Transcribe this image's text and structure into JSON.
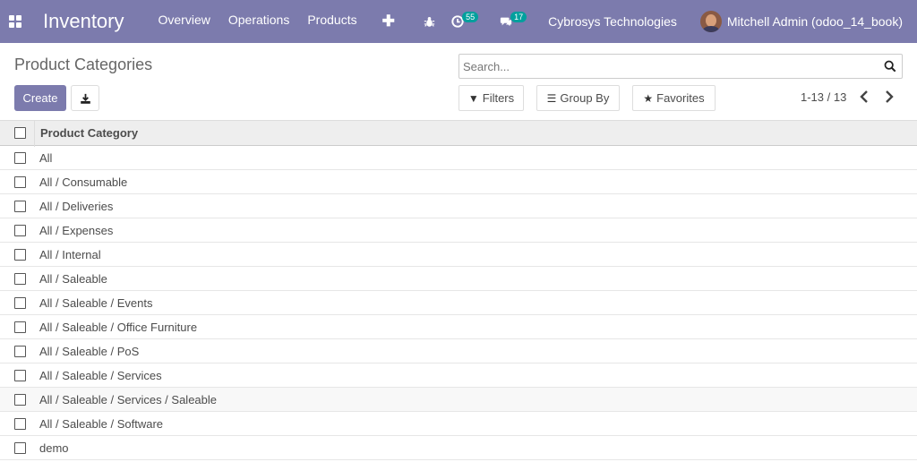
{
  "navbar": {
    "app_name": "Inventory",
    "menu": [
      "Overview",
      "Operations",
      "Products"
    ],
    "plus_label": "✚",
    "activity_count": "55",
    "messages_count": "17",
    "company": "Cybrosys Technologies",
    "user": "Mitchell Admin (odoo_14_book)",
    "colors": {
      "bar": "#7c7bad",
      "badge": "#00a09d"
    }
  },
  "control": {
    "title": "Product Categories",
    "search_placeholder": "Search...",
    "create_label": "Create",
    "filters_label": "Filters",
    "groupby_label": "Group By",
    "favorites_label": "Favorites",
    "pager": "1-13 / 13"
  },
  "table": {
    "header": "Product Category",
    "rows": [
      "All",
      "All / Consumable",
      "All / Deliveries",
      "All / Expenses",
      "All / Internal",
      "All / Saleable",
      "All / Saleable / Events",
      "All / Saleable / Office Furniture",
      "All / Saleable / PoS",
      "All / Saleable / Services",
      "All / Saleable / Services / Saleable",
      "All / Saleable / Software",
      "demo"
    ]
  }
}
